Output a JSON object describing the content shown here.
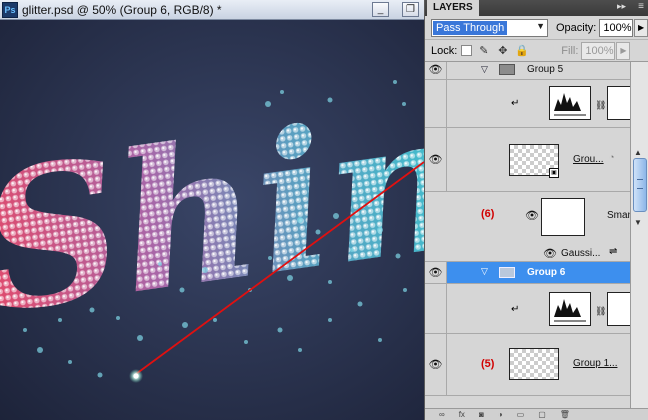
{
  "document": {
    "title": "glitter.psd @ 50% (Group 6, RGB/8) *",
    "canvas_text": "Shin",
    "app_icon": "Ps"
  },
  "window_controls": {
    "minimize": "_",
    "restore": "❐"
  },
  "layers_panel": {
    "tab_label": "LAYERS",
    "blend_mode": "Pass Through",
    "opacity_label": "Opacity:",
    "opacity_value": "100%",
    "lock_label": "Lock:",
    "fill_label": "Fill:",
    "fill_value": "100%",
    "layers": [
      {
        "name": "Group 5",
        "type": "group",
        "visible": true
      },
      {
        "name": "",
        "type": "adjustment",
        "visible": false
      },
      {
        "name": "Grou...",
        "type": "smart-group",
        "visible": true
      },
      {
        "name": "Sman",
        "type": "smart-object",
        "visible": true,
        "annotation": "(6)"
      },
      {
        "name": "Gaussi...",
        "type": "filter",
        "visible": true
      },
      {
        "name": "Group 6",
        "type": "group",
        "visible": true,
        "selected": true
      },
      {
        "name": "",
        "type": "adjustment",
        "visible": false
      },
      {
        "name": "Group 1...",
        "type": "group-thumb",
        "visible": true,
        "annotation": "(5)"
      }
    ]
  },
  "annotation_colors": {
    "red": "#d10000",
    "selection": "#3d8fee"
  }
}
